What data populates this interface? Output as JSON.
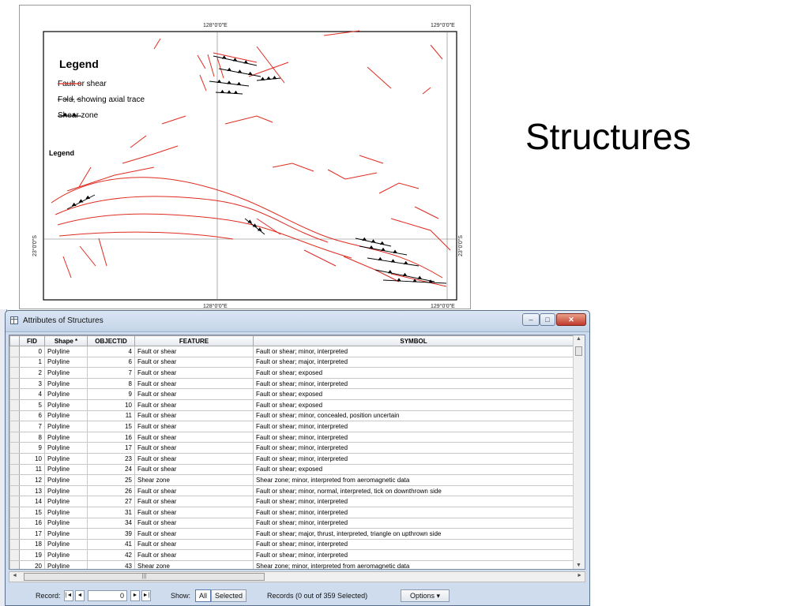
{
  "slide": {
    "title": "Structures"
  },
  "map": {
    "top_coords": [
      "128°0'0\"E",
      "129°0'0\"E"
    ],
    "bottom_coords": [
      "128°0'0\"E",
      "129°0'0\"E"
    ],
    "left_coord": "23°0'0\"S",
    "right_coord": "23°0'0\"S",
    "legend_title": "Legend",
    "legend_items": [
      {
        "label": "Fault or shear",
        "style": "solid",
        "color": "#e02b20"
      },
      {
        "label": "Fold, showing axial trace",
        "style": "dashed",
        "color": "#000000"
      },
      {
        "label": "Shear zone",
        "style": "triangles",
        "color": "#000000"
      }
    ],
    "legend_small": "Legend"
  },
  "attr_window": {
    "title": "Attributes of Structures",
    "columns": [
      "FID",
      "Shape *",
      "OBJECTID",
      "FEATURE",
      "SYMBOL"
    ],
    "rows": [
      [
        "0",
        "Polyline",
        "4",
        "Fault or shear",
        "Fault or shear; minor, interpreted"
      ],
      [
        "1",
        "Polyline",
        "6",
        "Fault or shear",
        "Fault or shear; major, interpreted"
      ],
      [
        "2",
        "Polyline",
        "7",
        "Fault or shear",
        "Fault or shear; exposed"
      ],
      [
        "3",
        "Polyline",
        "8",
        "Fault or shear",
        "Fault or shear; minor, interpreted"
      ],
      [
        "4",
        "Polyline",
        "9",
        "Fault or shear",
        "Fault or shear; exposed"
      ],
      [
        "5",
        "Polyline",
        "10",
        "Fault or shear",
        "Fault or shear; exposed"
      ],
      [
        "6",
        "Polyline",
        "11",
        "Fault or shear",
        "Fault or shear; minor, concealed, position uncertain"
      ],
      [
        "7",
        "Polyline",
        "15",
        "Fault or shear",
        "Fault or shear; minor, interpreted"
      ],
      [
        "8",
        "Polyline",
        "16",
        "Fault or shear",
        "Fault or shear; minor, interpreted"
      ],
      [
        "9",
        "Polyline",
        "17",
        "Fault or shear",
        "Fault or shear; minor, interpreted"
      ],
      [
        "10",
        "Polyline",
        "23",
        "Fault or shear",
        "Fault or shear; minor, interpreted"
      ],
      [
        "11",
        "Polyline",
        "24",
        "Fault or shear",
        "Fault or shear; exposed"
      ],
      [
        "12",
        "Polyline",
        "25",
        "Shear zone",
        "Shear zone; minor, interpreted from aeromagnetic data"
      ],
      [
        "13",
        "Polyline",
        "26",
        "Fault or shear",
        "Fault or shear; minor, normal, interpreted, tick on downthrown side"
      ],
      [
        "14",
        "Polyline",
        "27",
        "Fault or shear",
        "Fault or shear; minor, interpreted"
      ],
      [
        "15",
        "Polyline",
        "31",
        "Fault or shear",
        "Fault or shear; minor, interpreted"
      ],
      [
        "16",
        "Polyline",
        "34",
        "Fault or shear",
        "Fault or shear; minor, interpreted"
      ],
      [
        "17",
        "Polyline",
        "39",
        "Fault or shear",
        "Fault or shear; major, thrust, interpreted, triangle on upthrown side"
      ],
      [
        "18",
        "Polyline",
        "41",
        "Fault or shear",
        "Fault or shear; minor, interpreted"
      ],
      [
        "19",
        "Polyline",
        "42",
        "Fault or shear",
        "Fault or shear; minor, interpreted"
      ],
      [
        "20",
        "Polyline",
        "43",
        "Shear zone",
        "Shear zone; minor, interpreted from aeromagnetic data"
      ]
    ],
    "status": {
      "record_label": "Record:",
      "record_value": "0",
      "show_label": "Show:",
      "show_all": "All",
      "show_selected": "Selected",
      "records_text": "Records (0 out of 359 Selected)",
      "options_label": "Options"
    },
    "colors": {
      "fault": "#e02b20",
      "titlebar": "#c4d4e8",
      "close": "#c0392b"
    }
  }
}
